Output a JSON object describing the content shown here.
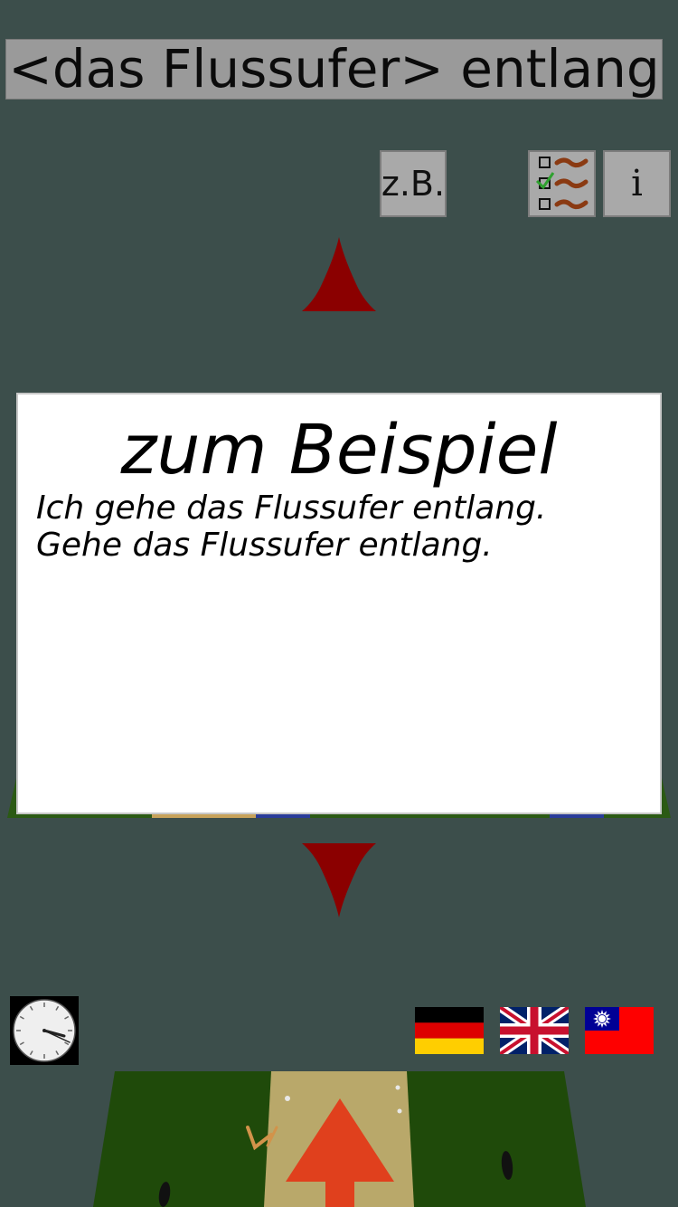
{
  "header": {
    "title": "<das Flussufer> entlang"
  },
  "toolbar": {
    "example_label": "z.B.",
    "list_icon": "checklist-icon",
    "info_label": "i"
  },
  "card": {
    "heading": "zum Beispiel",
    "examples": [
      "Ich gehe das Flussufer entlang.",
      "Gehe das Flussufer entlang."
    ]
  },
  "navigation": {
    "up_icon": "triangle-up-icon",
    "down_icon": "triangle-down-icon"
  },
  "languages": [
    "flag-germany-icon",
    "flag-uk-icon",
    "flag-taiwan-icon"
  ],
  "colors": {
    "background": "#3c4e4b",
    "arrow_red": "#8b0000",
    "button_gray": "#a9a9a9",
    "field_green": "#1f4a0a"
  }
}
